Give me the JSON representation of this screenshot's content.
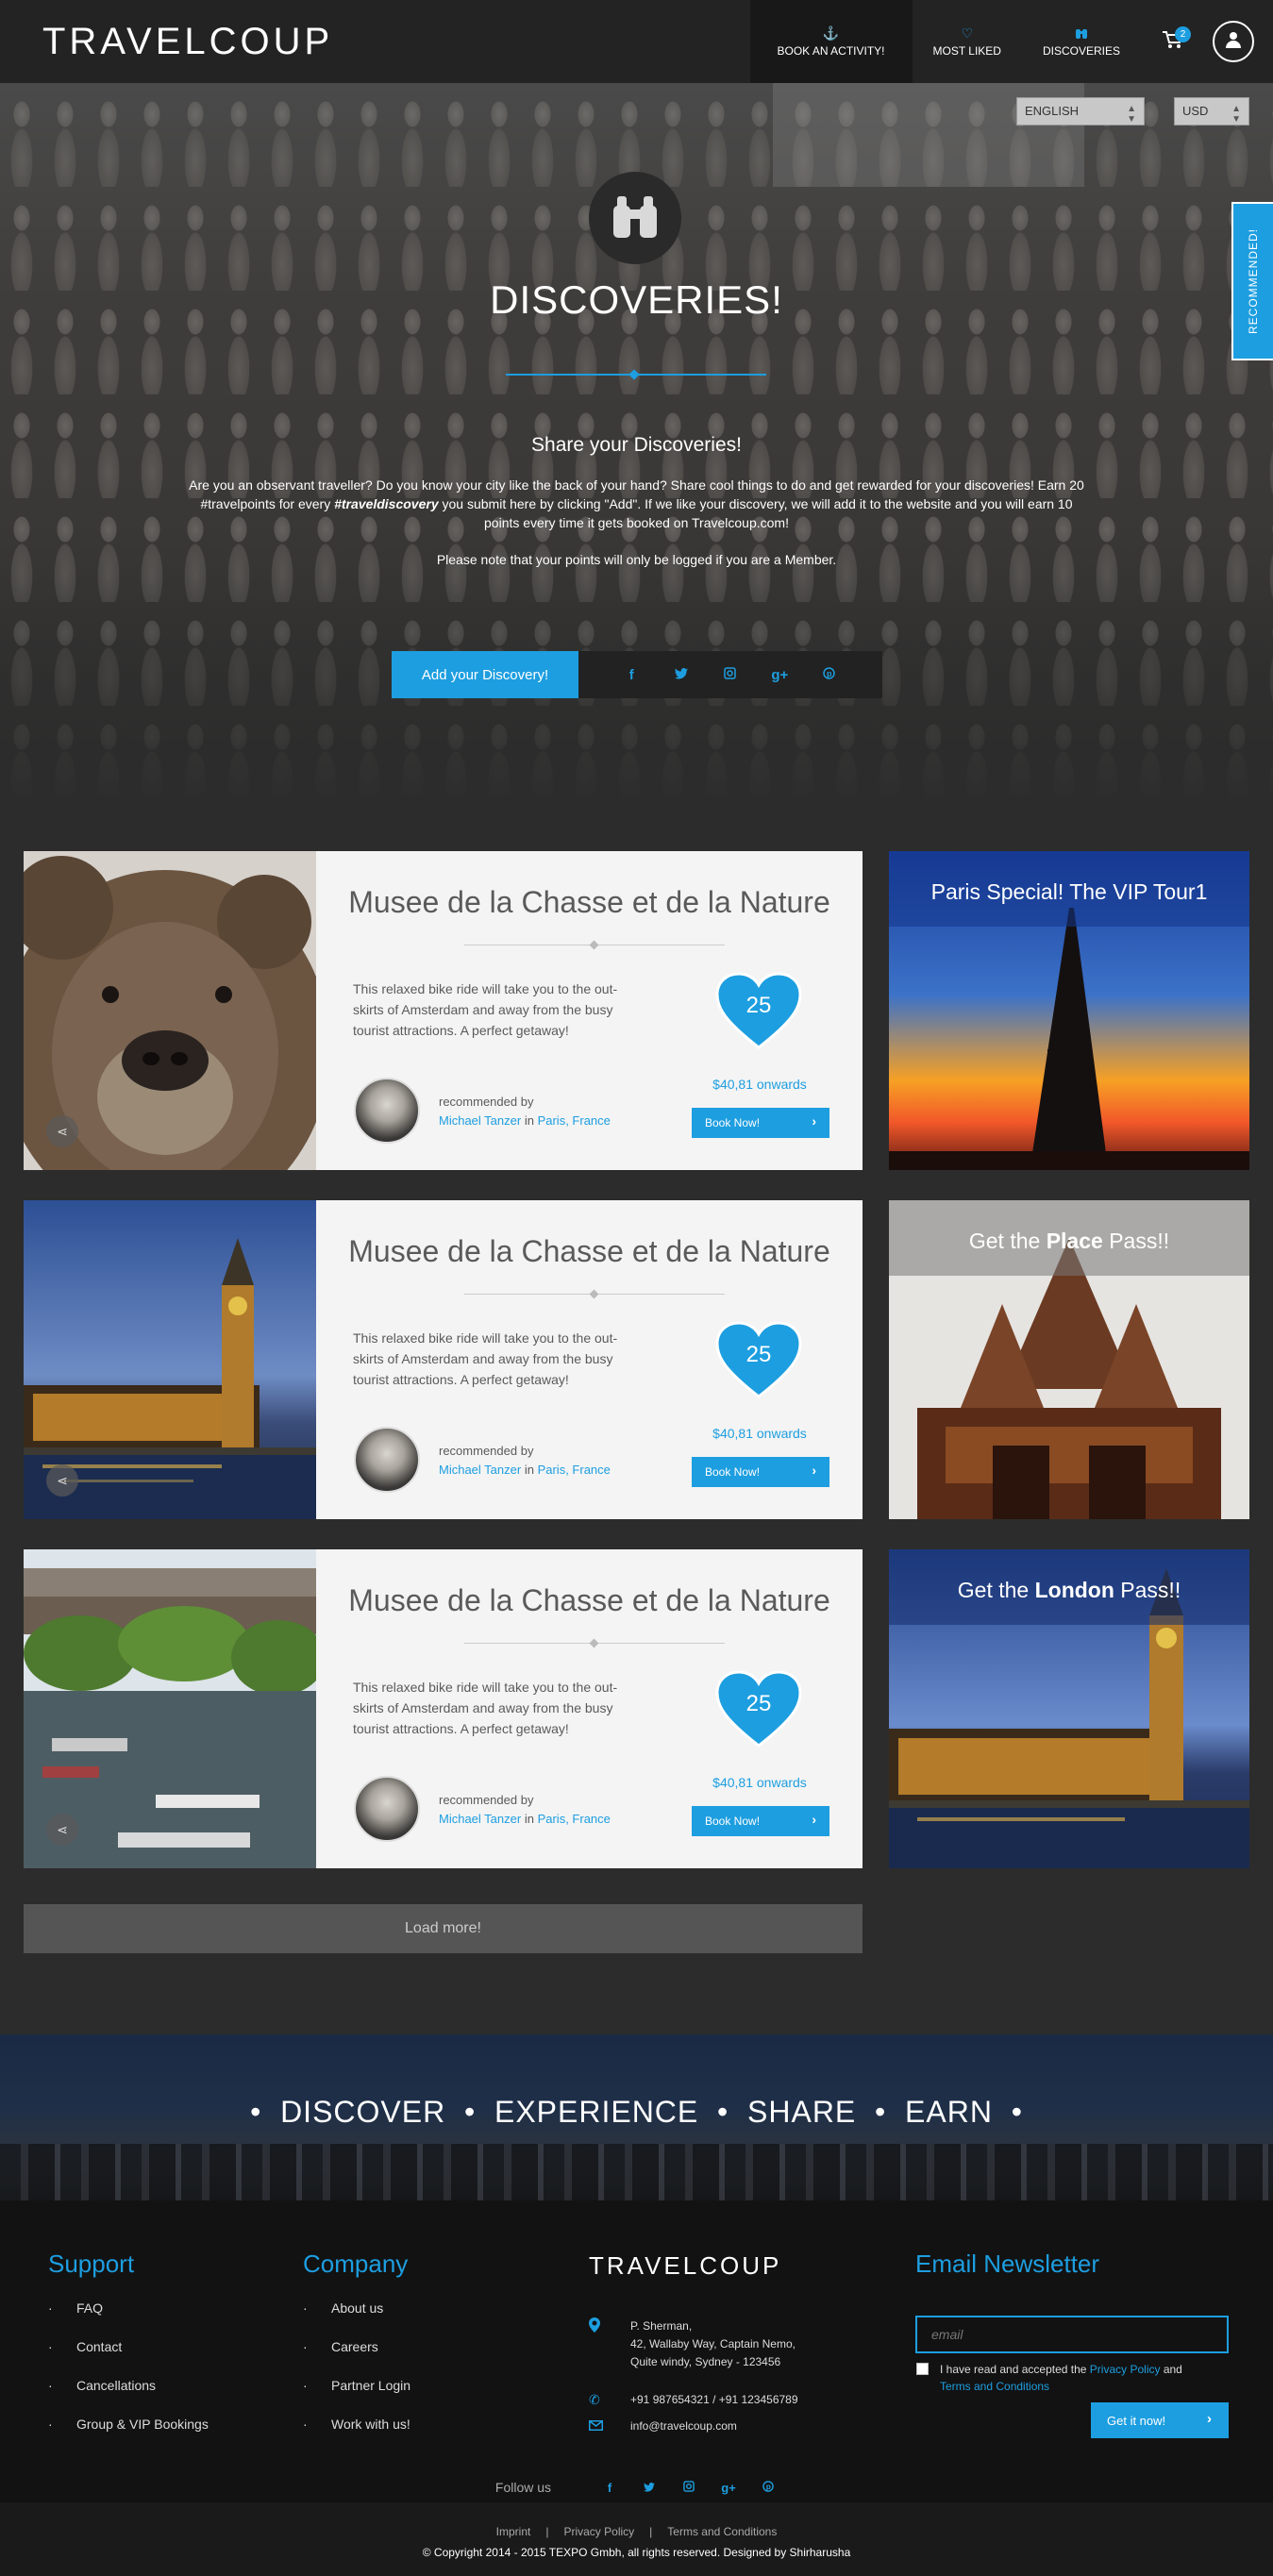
{
  "header": {
    "logo": "TRAVELCOUP",
    "nav": [
      {
        "label": "BOOK AN ACTIVITY!",
        "icon": "anchor-icon"
      },
      {
        "label": "MOST LIKED",
        "icon": "heart-outline-icon"
      },
      {
        "label": "DISCOVERIES",
        "icon": "binoculars-icon"
      }
    ],
    "cart_count": "2"
  },
  "hero": {
    "language": "ENGLISH",
    "currency": "USD",
    "title": "DISCOVERIES!",
    "subtitle": "Share your Discoveries!",
    "text_part1": "Are you an observant traveller? Do you know your city like the back of your hand? Share cool things to do and get rewarded for your discoveries! Earn 20 #travelpoints for every ",
    "text_em": "#traveldiscovery",
    "text_part2": " you submit here by clicking \"Add\". If we like your discovery, we will add it to the website and you will earn 10 points every time it gets booked on Travelcoup.com!",
    "note": "Please note that your points will only be logged if you are a Member.",
    "add_button": "Add your Discovery!",
    "recommended_tab": "RECOMMENDED!"
  },
  "listings": [
    {
      "title": "Musee de la Chasse et de la Nature",
      "description": "This relaxed bike ride will take you to the out-skirts of Amsterdam and away from the busy tourist attractions. A perfect getaway!",
      "likes": "25",
      "price": "$40,81 onwards",
      "book_label": "Book Now!",
      "rec_label": "recommended by",
      "rec_name": "Michael Tanzer",
      "rec_in": "in",
      "rec_place": "Paris, France",
      "image": "bear"
    },
    {
      "title": "Musee de la Chasse et de la Nature",
      "description": "This relaxed bike ride will take you to the out-skirts of Amsterdam and away from the busy tourist attractions. A perfect getaway!",
      "likes": "25",
      "price": "$40,81 onwards",
      "book_label": "Book Now!",
      "rec_label": "recommended by",
      "rec_name": "Michael Tanzer",
      "rec_in": "in",
      "rec_place": "Paris, France",
      "image": "big-ben"
    },
    {
      "title": "Musee de la Chasse et de la Nature",
      "description": "This relaxed bike ride will take you to the out-skirts of Amsterdam and away from the busy tourist attractions. A perfect getaway!",
      "likes": "25",
      "price": "$40,81 onwards",
      "book_label": "Book Now!",
      "rec_label": "recommended by",
      "rec_name": "Michael Tanzer",
      "rec_in": "in",
      "rec_place": "Paris, France",
      "image": "amsterdam"
    }
  ],
  "promos": [
    {
      "title": "Paris Special! The VIP Tour1",
      "pre": "",
      "bold": "",
      "post": ""
    },
    {
      "title": "",
      "pre": "Get the ",
      "bold": "Place",
      "post": " Pass!!"
    },
    {
      "title": "",
      "pre": "Get the ",
      "bold": "London",
      "post": " Pass!!"
    }
  ],
  "load_more": "Load more!",
  "banner": {
    "words": [
      "DISCOVER",
      "EXPERIENCE",
      "SHARE",
      "EARN"
    ],
    "bullet": "•"
  },
  "footer": {
    "support_title": "Support",
    "support_items": [
      "FAQ",
      "Contact",
      "Cancellations",
      "Group & VIP Bookings"
    ],
    "company_title": "Company",
    "company_items": [
      "About us",
      "Careers",
      "Partner Login",
      "Work with us!"
    ],
    "logo": "TRAVELCOUP",
    "address_line1": "P. Sherman,",
    "address_line2": "42, Wallaby Way, Captain Nemo,",
    "address_line3": "Quite windy, Sydney - 123456",
    "phones": "+91 987654321  /  +91 123456789",
    "email": "info@travelcoup.com",
    "newsletter_title": "Email Newsletter",
    "email_placeholder": "email",
    "terms_pre": "I have read and accepted the ",
    "terms_privacy": "Privacy Policy",
    "terms_and": " and",
    "terms_link": "Terms and Conditions",
    "submit": "Get it now!",
    "follow": "Follow us",
    "bottom_links": [
      "Imprint",
      "Privacy Policy",
      "Terms and Conditions"
    ],
    "separator": "|",
    "copyright": "© Copyright 2014 - 2015 TEXPO Gmbh, all rights reserved. Designed by Shirharusha"
  },
  "colors": {
    "accent": "#1d9ee0",
    "dark": "#232323",
    "card": "#f4f4f4"
  }
}
